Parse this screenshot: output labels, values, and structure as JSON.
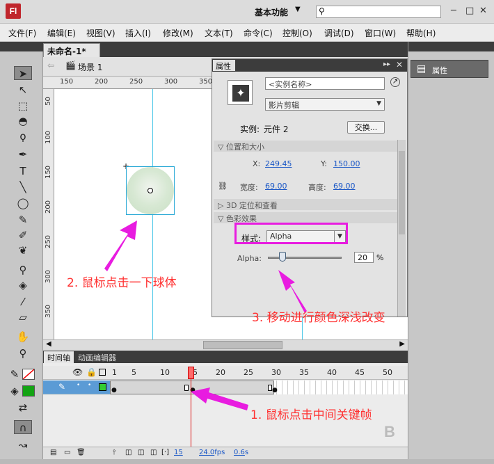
{
  "app": {
    "logo": "Fl",
    "workspace": "基本功能",
    "search_placeholder": "",
    "win_min": "─",
    "win_max": "□",
    "win_close": "✕"
  },
  "menu": [
    "文件(F)",
    "编辑(E)",
    "视图(V)",
    "插入(I)",
    "修改(M)",
    "文本(T)",
    "命令(C)",
    "控制(O)",
    "调试(D)",
    "窗口(W)",
    "帮助(H)"
  ],
  "doc": {
    "tab": "未命名-1*",
    "close": "×",
    "scene": "场景 1"
  },
  "ruler_top": [
    "150",
    "200",
    "250",
    "300",
    "350"
  ],
  "ruler_left": [
    "50",
    "100",
    "150",
    "200",
    "250",
    "300",
    "350"
  ],
  "properties": {
    "tab": "属性",
    "instance_name_placeholder": "<实例名称>",
    "symbol_type": "影片剪辑",
    "instance_label": "实例:",
    "instance_value": "元件 2",
    "swap_button": "交换...",
    "section_position": "位置和大小",
    "x_label": "X:",
    "x_value": "249.45",
    "y_label": "Y:",
    "y_value": "150.00",
    "w_label": "宽度:",
    "w_value": "69.00",
    "h_label": "高度:",
    "h_value": "69.00",
    "section_3d": "3D 定位和查看",
    "section_color": "色彩效果",
    "style_label": "样式:",
    "style_value": "Alpha",
    "alpha_label": "Alpha:",
    "alpha_value": "20",
    "alpha_unit": "%",
    "alpha_level": 0.2
  },
  "right_dock": {
    "properties_tile": "属性"
  },
  "timeline": {
    "tab_timeline": "时间轴",
    "tab_motion": "动画编辑器",
    "frame_numbers": [
      "1",
      "5",
      "10",
      "15",
      "20",
      "25",
      "30",
      "35",
      "40",
      "45",
      "50"
    ],
    "current_frame": "15",
    "fps": "24.0",
    "fps_unit": "fps",
    "time": "0.6",
    "time_unit": "s"
  },
  "annotations": {
    "a1": "1. 鼠标点击中间关键帧",
    "a2": "2. 鼠标点击一下球体",
    "a3": "3. 移动进行颜色深浅改变"
  },
  "colors": {
    "annotation": "#ff3030",
    "highlight": "#e81ce0",
    "layer": "#5b9bd5"
  }
}
